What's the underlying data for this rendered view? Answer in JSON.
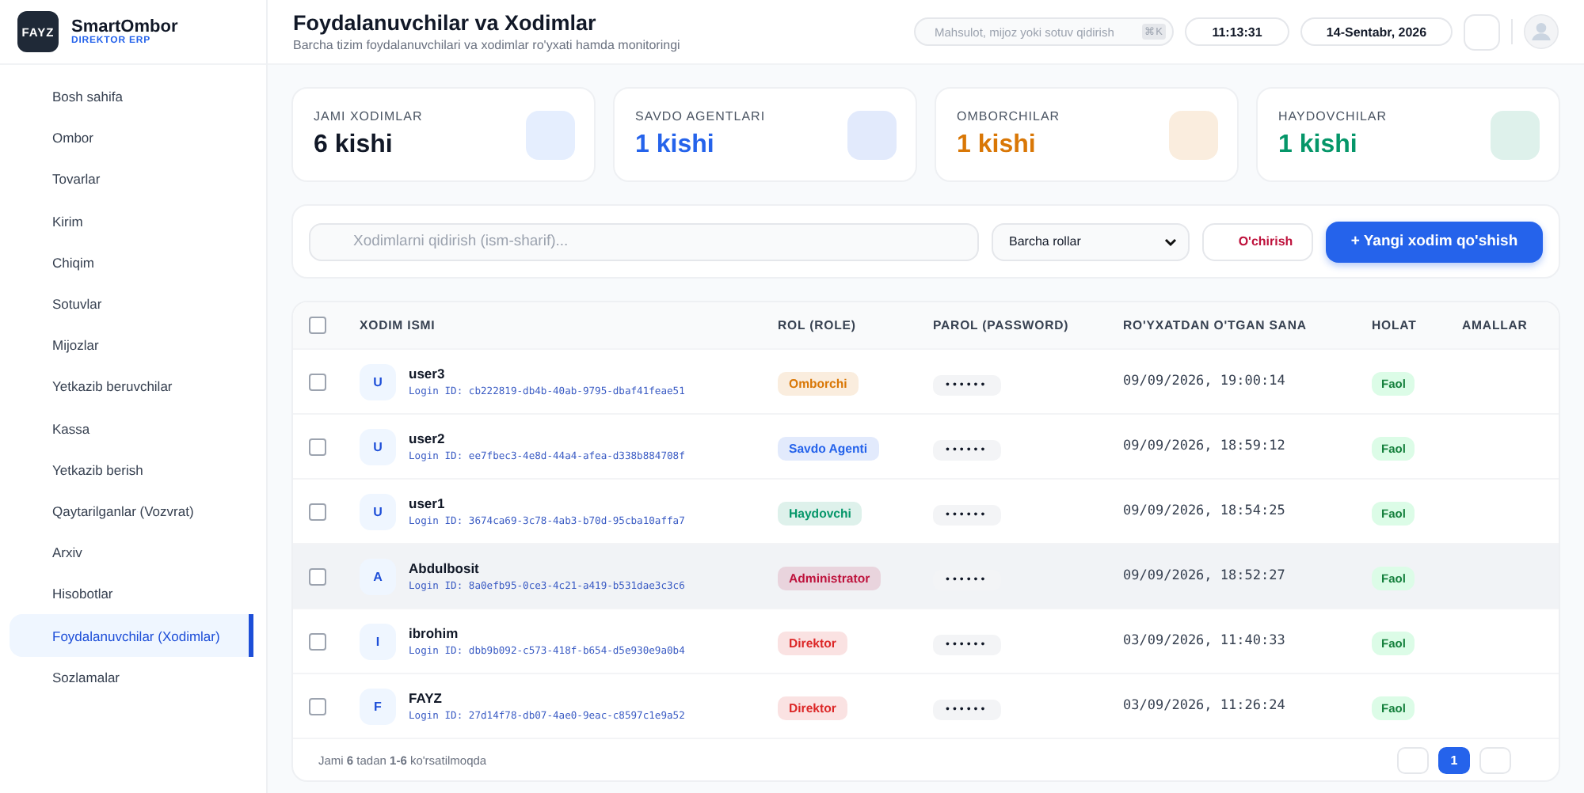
{
  "brand": {
    "logo": "FAYZ",
    "name": "SmartOmbor",
    "subtitle": "DIREKTOR ERP"
  },
  "sidebar": {
    "items": [
      {
        "label": "Bosh sahifa",
        "selected": false
      },
      {
        "label": "Ombor",
        "selected": false
      },
      {
        "label": "Tovarlar",
        "selected": false
      },
      {
        "label": "Kirim",
        "selected": false
      },
      {
        "label": "Chiqim",
        "selected": false
      },
      {
        "label": "Sotuvlar",
        "selected": false
      },
      {
        "label": "Mijozlar",
        "selected": false
      },
      {
        "label": "Yetkazib beruvchilar",
        "selected": false
      },
      {
        "label": "Kassa",
        "selected": false
      },
      {
        "label": "Yetkazib berish",
        "selected": false
      },
      {
        "label": "Qaytarilganlar (Vozvrat)",
        "selected": false
      },
      {
        "label": "Arxiv",
        "selected": false
      },
      {
        "label": "Hisobotlar",
        "selected": false
      },
      {
        "label": "Foydalanuvchilar (Xodimlar)",
        "selected": true
      },
      {
        "label": "Sozlamalar",
        "selected": false
      }
    ]
  },
  "header": {
    "title": "Foydalanuvchilar va Xodimlar",
    "subtitle": "Barcha tizim foydalanuvchilari va xodimlar ro'yxati hamda monitoringi",
    "search": {
      "placeholder": "Mahsulot, mijoz yoki sotuv qidirish",
      "shortcut": "⌘K"
    },
    "time": "11:13:31",
    "date": "14-Sentabr, 2026"
  },
  "stats": [
    {
      "label": "JAMI XODIMLAR",
      "value": "6 kishi",
      "color": "#111827"
    },
    {
      "label": "SAVDO AGENTLARI",
      "value": "1 kishi",
      "color": "#2563eb"
    },
    {
      "label": "OMBORCHILAR",
      "value": "1 kishi",
      "color": "#d97706"
    },
    {
      "label": "HAYDOVCHILAR",
      "value": "1 kishi",
      "color": "#059669"
    }
  ],
  "toolbar": {
    "search": {
      "placeholder": "Xodimlarni qidirish (ism-sharif)..."
    },
    "role_filter": "Barcha rollar",
    "delete_button": "O'chirish",
    "add_button": "+ Yangi xodim qo'shish"
  },
  "table": {
    "columns": [
      "XODIM ISMI",
      "ROL (ROLE)",
      "PAROL (PASSWORD)",
      "RO'YXATDAN O'TGAN SANA",
      "HOLAT",
      "AMALLAR"
    ],
    "all_checked": false,
    "rows": [
      {
        "initial": "U",
        "name": "user3",
        "login_id": "Login ID: cb222819-db4b-40ab-9795-dbaf41feae51",
        "role": "Omborchi",
        "color": "#d97706",
        "password": "••••••",
        "date": "09/09/2026, 19:00:14",
        "status": "Faol",
        "checked": false,
        "hovered": false
      },
      {
        "initial": "U",
        "name": "user2",
        "login_id": "Login ID: ee7fbec3-4e8d-44a4-afea-d338b884708f",
        "role": "Savdo Agenti",
        "color": "#2563eb",
        "password": "••••••",
        "date": "09/09/2026, 18:59:12",
        "status": "Faol",
        "checked": false,
        "hovered": false
      },
      {
        "initial": "U",
        "name": "user1",
        "login_id": "Login ID: 3674ca69-3c78-4ab3-b70d-95cba10affa7",
        "role": "Haydovchi",
        "color": "#059669",
        "password": "••••••",
        "date": "09/09/2026, 18:54:25",
        "status": "Faol",
        "checked": false,
        "hovered": false
      },
      {
        "initial": "A",
        "name": "Abdulbosit",
        "login_id": "Login ID: 8a0efb95-0ce3-4c21-a419-b531dae3c3c6",
        "role": "Administrator",
        "color": "#be123c",
        "password": "••••••",
        "date": "09/09/2026, 18:52:27",
        "status": "Faol",
        "checked": false,
        "hovered": true
      },
      {
        "initial": "I",
        "name": "ibrohim",
        "login_id": "Login ID: dbb9b092-c573-418f-b654-d5e930e9a0b4",
        "role": "Direktor",
        "color": "#dc2626",
        "password": "••••••",
        "date": "03/09/2026, 11:40:33",
        "status": "Faol",
        "checked": false,
        "hovered": false
      },
      {
        "initial": "F",
        "name": "FAYZ",
        "login_id": "Login ID: 27d14f78-db07-4ae0-9eac-c8597c1e9a52",
        "role": "Direktor",
        "color": "#dc2626",
        "password": "••••••",
        "date": "03/09/2026, 11:26:24",
        "status": "Faol",
        "checked": false,
        "hovered": false
      }
    ],
    "footer": "Jami **6** tadan **1-6** ko'rsatilmoqda",
    "pages": [
      {
        "label": "1",
        "selected": true
      }
    ]
  }
}
